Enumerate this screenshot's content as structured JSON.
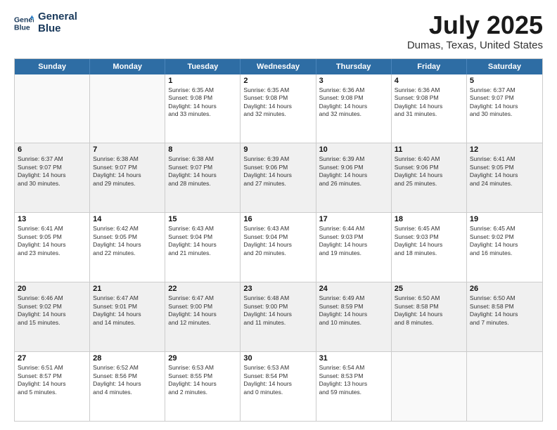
{
  "header": {
    "logo_line1": "General",
    "logo_line2": "Blue",
    "title": "July 2025",
    "subtitle": "Dumas, Texas, United States"
  },
  "days_of_week": [
    "Sunday",
    "Monday",
    "Tuesday",
    "Wednesday",
    "Thursday",
    "Friday",
    "Saturday"
  ],
  "weeks": [
    [
      {
        "day": "",
        "text": "",
        "empty": true
      },
      {
        "day": "",
        "text": "",
        "empty": true
      },
      {
        "day": "1",
        "text": "Sunrise: 6:35 AM\nSunset: 9:08 PM\nDaylight: 14 hours\nand 33 minutes."
      },
      {
        "day": "2",
        "text": "Sunrise: 6:35 AM\nSunset: 9:08 PM\nDaylight: 14 hours\nand 32 minutes."
      },
      {
        "day": "3",
        "text": "Sunrise: 6:36 AM\nSunset: 9:08 PM\nDaylight: 14 hours\nand 32 minutes."
      },
      {
        "day": "4",
        "text": "Sunrise: 6:36 AM\nSunset: 9:08 PM\nDaylight: 14 hours\nand 31 minutes."
      },
      {
        "day": "5",
        "text": "Sunrise: 6:37 AM\nSunset: 9:07 PM\nDaylight: 14 hours\nand 30 minutes."
      }
    ],
    [
      {
        "day": "6",
        "text": "Sunrise: 6:37 AM\nSunset: 9:07 PM\nDaylight: 14 hours\nand 30 minutes.",
        "shaded": true
      },
      {
        "day": "7",
        "text": "Sunrise: 6:38 AM\nSunset: 9:07 PM\nDaylight: 14 hours\nand 29 minutes.",
        "shaded": true
      },
      {
        "day": "8",
        "text": "Sunrise: 6:38 AM\nSunset: 9:07 PM\nDaylight: 14 hours\nand 28 minutes.",
        "shaded": true
      },
      {
        "day": "9",
        "text": "Sunrise: 6:39 AM\nSunset: 9:06 PM\nDaylight: 14 hours\nand 27 minutes.",
        "shaded": true
      },
      {
        "day": "10",
        "text": "Sunrise: 6:39 AM\nSunset: 9:06 PM\nDaylight: 14 hours\nand 26 minutes.",
        "shaded": true
      },
      {
        "day": "11",
        "text": "Sunrise: 6:40 AM\nSunset: 9:06 PM\nDaylight: 14 hours\nand 25 minutes.",
        "shaded": true
      },
      {
        "day": "12",
        "text": "Sunrise: 6:41 AM\nSunset: 9:05 PM\nDaylight: 14 hours\nand 24 minutes.",
        "shaded": true
      }
    ],
    [
      {
        "day": "13",
        "text": "Sunrise: 6:41 AM\nSunset: 9:05 PM\nDaylight: 14 hours\nand 23 minutes."
      },
      {
        "day": "14",
        "text": "Sunrise: 6:42 AM\nSunset: 9:05 PM\nDaylight: 14 hours\nand 22 minutes."
      },
      {
        "day": "15",
        "text": "Sunrise: 6:43 AM\nSunset: 9:04 PM\nDaylight: 14 hours\nand 21 minutes."
      },
      {
        "day": "16",
        "text": "Sunrise: 6:43 AM\nSunset: 9:04 PM\nDaylight: 14 hours\nand 20 minutes."
      },
      {
        "day": "17",
        "text": "Sunrise: 6:44 AM\nSunset: 9:03 PM\nDaylight: 14 hours\nand 19 minutes."
      },
      {
        "day": "18",
        "text": "Sunrise: 6:45 AM\nSunset: 9:03 PM\nDaylight: 14 hours\nand 18 minutes."
      },
      {
        "day": "19",
        "text": "Sunrise: 6:45 AM\nSunset: 9:02 PM\nDaylight: 14 hours\nand 16 minutes."
      }
    ],
    [
      {
        "day": "20",
        "text": "Sunrise: 6:46 AM\nSunset: 9:02 PM\nDaylight: 14 hours\nand 15 minutes.",
        "shaded": true
      },
      {
        "day": "21",
        "text": "Sunrise: 6:47 AM\nSunset: 9:01 PM\nDaylight: 14 hours\nand 14 minutes.",
        "shaded": true
      },
      {
        "day": "22",
        "text": "Sunrise: 6:47 AM\nSunset: 9:00 PM\nDaylight: 14 hours\nand 12 minutes.",
        "shaded": true
      },
      {
        "day": "23",
        "text": "Sunrise: 6:48 AM\nSunset: 9:00 PM\nDaylight: 14 hours\nand 11 minutes.",
        "shaded": true
      },
      {
        "day": "24",
        "text": "Sunrise: 6:49 AM\nSunset: 8:59 PM\nDaylight: 14 hours\nand 10 minutes.",
        "shaded": true
      },
      {
        "day": "25",
        "text": "Sunrise: 6:50 AM\nSunset: 8:58 PM\nDaylight: 14 hours\nand 8 minutes.",
        "shaded": true
      },
      {
        "day": "26",
        "text": "Sunrise: 6:50 AM\nSunset: 8:58 PM\nDaylight: 14 hours\nand 7 minutes.",
        "shaded": true
      }
    ],
    [
      {
        "day": "27",
        "text": "Sunrise: 6:51 AM\nSunset: 8:57 PM\nDaylight: 14 hours\nand 5 minutes."
      },
      {
        "day": "28",
        "text": "Sunrise: 6:52 AM\nSunset: 8:56 PM\nDaylight: 14 hours\nand 4 minutes."
      },
      {
        "day": "29",
        "text": "Sunrise: 6:53 AM\nSunset: 8:55 PM\nDaylight: 14 hours\nand 2 minutes."
      },
      {
        "day": "30",
        "text": "Sunrise: 6:53 AM\nSunset: 8:54 PM\nDaylight: 14 hours\nand 0 minutes."
      },
      {
        "day": "31",
        "text": "Sunrise: 6:54 AM\nSunset: 8:53 PM\nDaylight: 13 hours\nand 59 minutes."
      },
      {
        "day": "",
        "text": "",
        "empty": true
      },
      {
        "day": "",
        "text": "",
        "empty": true
      }
    ]
  ]
}
